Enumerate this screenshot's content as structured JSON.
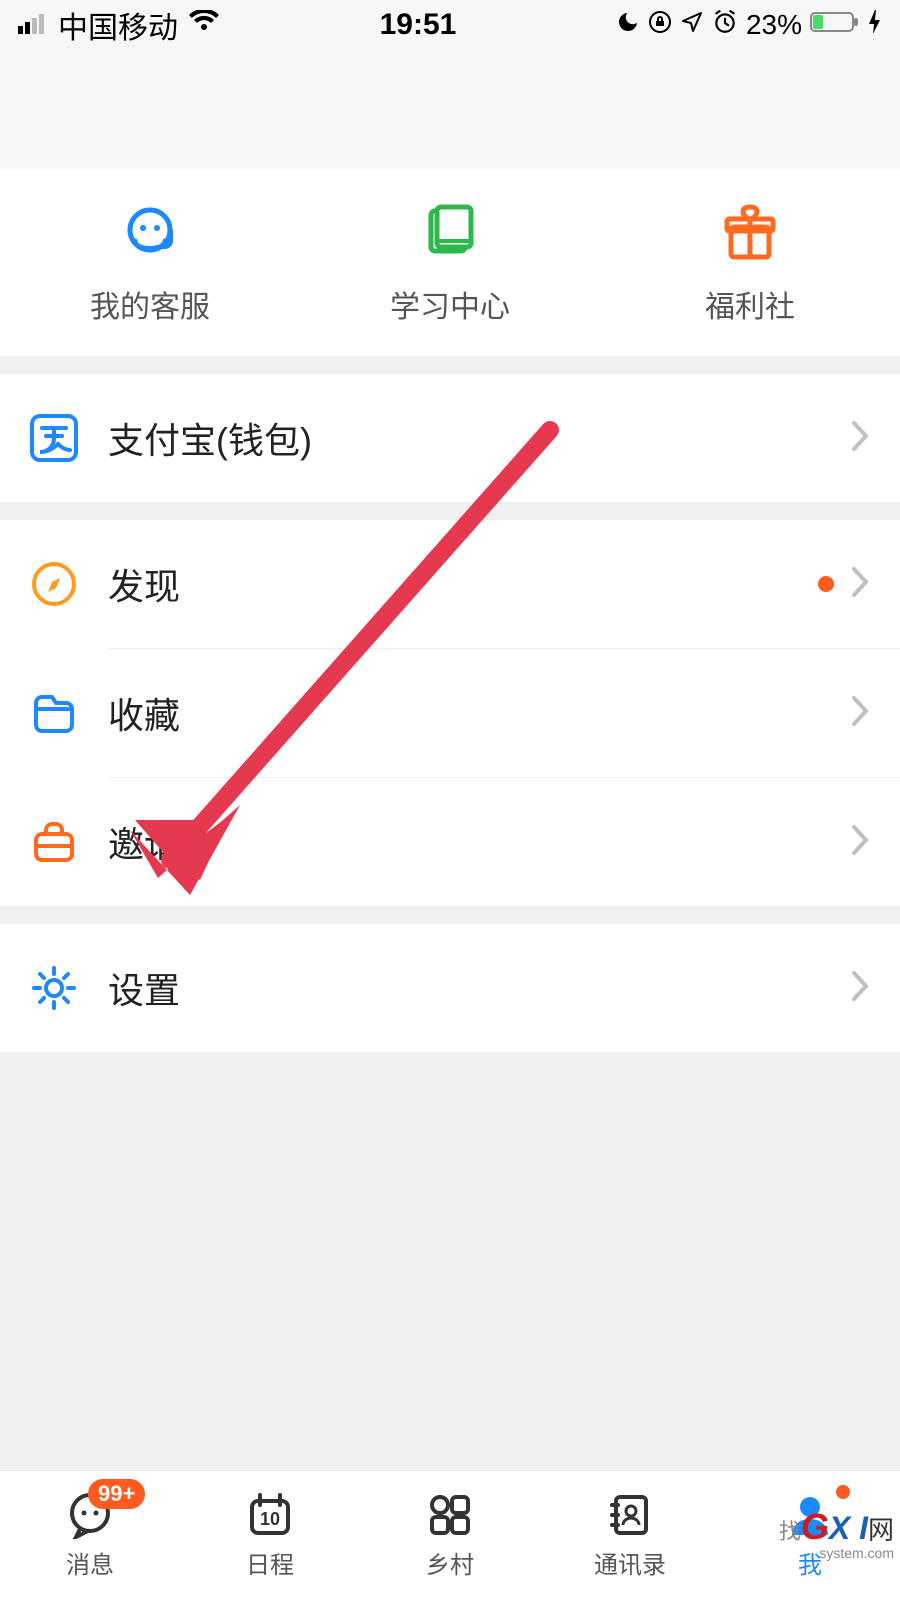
{
  "status": {
    "carrier": "中国移动",
    "time": "19:51",
    "battery": "23%"
  },
  "top": [
    {
      "label": "我的客服"
    },
    {
      "label": "学习中心"
    },
    {
      "label": "福利社"
    }
  ],
  "rows": {
    "alipay": "支付宝(钱包)",
    "discover": "发现",
    "favorites": "收藏",
    "invite": "邀请",
    "settings": "设置"
  },
  "tabs": [
    {
      "label": "消息",
      "badge": "99+"
    },
    {
      "label": "日程",
      "date": "10"
    },
    {
      "label": "乡村"
    },
    {
      "label": "通讯录"
    },
    {
      "label": "我"
    }
  ],
  "watermark": {
    "g": "G",
    "xi": "X I",
    "w": "网",
    "s": "system.com",
    "pre": "找"
  }
}
